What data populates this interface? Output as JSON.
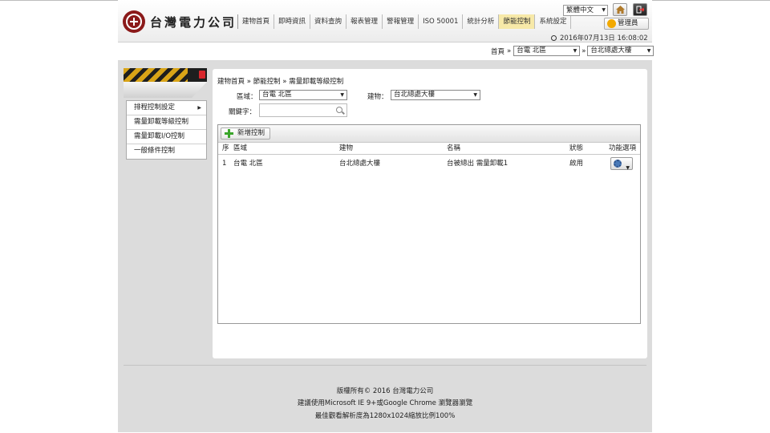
{
  "header": {
    "logo_text": "台灣電力公司",
    "nav": [
      "建物首頁",
      "即時資訊",
      "資料查詢",
      "報表管理",
      "警報管理",
      "ISO 50001",
      "統計分析",
      "節能控制",
      "系統設定"
    ],
    "active_nav_index": 7,
    "language": "繁體中文",
    "admin_label": "管理員",
    "datetime": "2016年07月13日 16:08:02"
  },
  "breadcrumb": {
    "home": "首頁",
    "sep": "»",
    "region": "台電 北區",
    "building": "台北總處大樓"
  },
  "sidebar": {
    "items": [
      {
        "label": "排程控制設定",
        "has_submenu": true
      },
      {
        "label": "需量卸載等級控制",
        "has_submenu": false
      },
      {
        "label": "需量卸載I/O控制",
        "has_submenu": false
      },
      {
        "label": "一般條件控制",
        "has_submenu": false
      }
    ]
  },
  "content": {
    "breadcrumb": "建物首頁 » 節能控制 » 需量卸載等級控制",
    "region_label": "區域：",
    "region_value": "台電 北區",
    "building_label": "建物：",
    "building_value": "台北總處大樓",
    "keyword_label": "關鍵字：",
    "keyword_value": "",
    "add_button": "新增控制",
    "columns": [
      "序",
      "區域",
      "建物",
      "名稱",
      "狀態",
      "功能選項"
    ],
    "rows": [
      {
        "index": "1",
        "region": "台電 北區",
        "building": "台北總處大樓",
        "name": "台被總出 需量卸載1",
        "status": "啟用"
      }
    ]
  },
  "footer": {
    "copyright": "版權所有© 2016 台灣電力公司",
    "browser": "建議使用Microsoft IE 9+或Google Chrome 瀏覽器瀏覽",
    "resolution": "最佳觀看解析度為1280x1024縮放比例100%"
  },
  "colors": {
    "active_nav": "#f7e9a8",
    "side_stripe": "#d9a417",
    "add_icon": "#3aa52a",
    "brand": "#8b1a1a"
  }
}
